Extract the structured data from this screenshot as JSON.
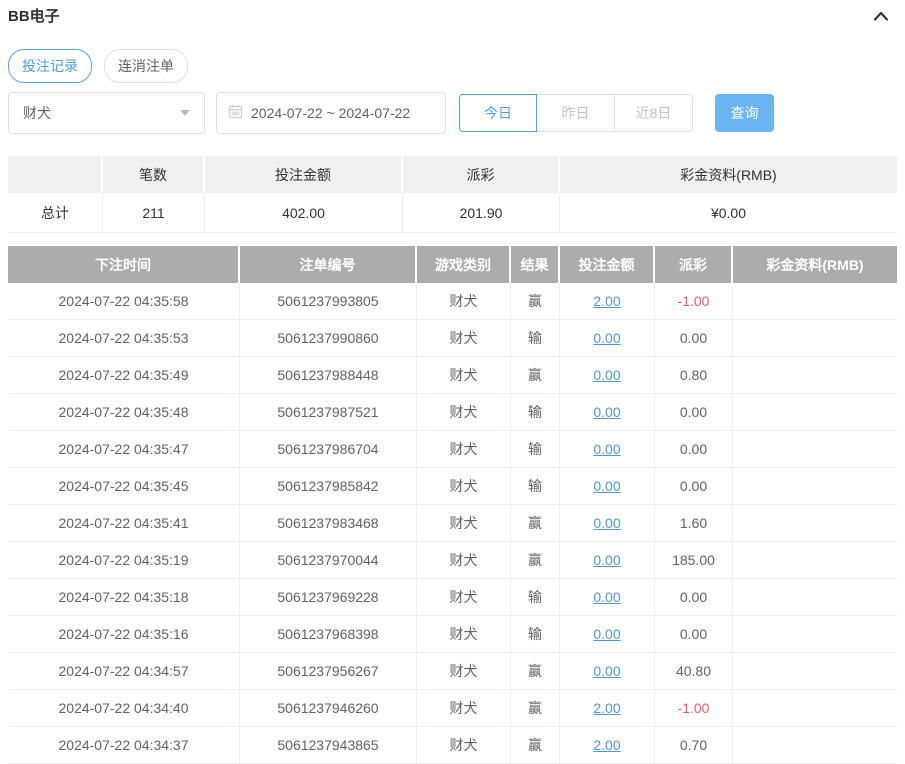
{
  "page": {
    "title": "BB电子"
  },
  "icons": {
    "collapse": "chevron-up-icon",
    "calendar": "calendar-icon",
    "select_caret": "caret-down-icon"
  },
  "colors": {
    "accent_blue": "#4f9fe8",
    "query_button_bg": "#6ab5f1",
    "link_blue": "#4e95dd",
    "negative_red": "#e85c66",
    "records_header_bg": "#acacac",
    "summary_header_bg": "#f0f0f0"
  },
  "tabs": [
    {
      "label": "投注记录",
      "active": true
    },
    {
      "label": "连消注单",
      "active": false
    }
  ],
  "filters": {
    "game_select": {
      "value": "财犬"
    },
    "date_range": {
      "value": "2024-07-22 ~ 2024-07-22"
    },
    "quick_buttons": [
      {
        "label": "今日",
        "active": true
      },
      {
        "label": "昨日",
        "active": false
      },
      {
        "label": "近8日",
        "active": false
      }
    ],
    "query_label": "查询"
  },
  "summary_table": {
    "headers": [
      "",
      "笔数",
      "投注金额",
      "派彩",
      "彩金资料(RMB)"
    ],
    "row": {
      "label": "总计",
      "count": "211",
      "bet_amount": "402.00",
      "payout": "201.90",
      "bonus": "¥0.00"
    }
  },
  "records_table": {
    "headers": [
      "下注时间",
      "注单编号",
      "游戏类别",
      "结果",
      "投注金额",
      "派彩",
      "彩金资料(RMB)"
    ],
    "rows": [
      {
        "time": "2024-07-22 04:35:58",
        "order_no": "5061237993805",
        "game": "财犬",
        "result": "赢",
        "bet_amount": "2.00",
        "payout": "-1.00",
        "bonus": ""
      },
      {
        "time": "2024-07-22 04:35:53",
        "order_no": "5061237990860",
        "game": "财犬",
        "result": "输",
        "bet_amount": "0.00",
        "payout": "0.00",
        "bonus": ""
      },
      {
        "time": "2024-07-22 04:35:49",
        "order_no": "5061237988448",
        "game": "财犬",
        "result": "赢",
        "bet_amount": "0.00",
        "payout": "0.80",
        "bonus": ""
      },
      {
        "time": "2024-07-22 04:35:48",
        "order_no": "5061237987521",
        "game": "财犬",
        "result": "输",
        "bet_amount": "0.00",
        "payout": "0.00",
        "bonus": ""
      },
      {
        "time": "2024-07-22 04:35:47",
        "order_no": "5061237986704",
        "game": "财犬",
        "result": "输",
        "bet_amount": "0.00",
        "payout": "0.00",
        "bonus": ""
      },
      {
        "time": "2024-07-22 04:35:45",
        "order_no": "5061237985842",
        "game": "财犬",
        "result": "输",
        "bet_amount": "0.00",
        "payout": "0.00",
        "bonus": ""
      },
      {
        "time": "2024-07-22 04:35:41",
        "order_no": "5061237983468",
        "game": "财犬",
        "result": "赢",
        "bet_amount": "0.00",
        "payout": "1.60",
        "bonus": ""
      },
      {
        "time": "2024-07-22 04:35:19",
        "order_no": "5061237970044",
        "game": "财犬",
        "result": "赢",
        "bet_amount": "0.00",
        "payout": "185.00",
        "bonus": ""
      },
      {
        "time": "2024-07-22 04:35:18",
        "order_no": "5061237969228",
        "game": "财犬",
        "result": "输",
        "bet_amount": "0.00",
        "payout": "0.00",
        "bonus": ""
      },
      {
        "time": "2024-07-22 04:35:16",
        "order_no": "5061237968398",
        "game": "财犬",
        "result": "输",
        "bet_amount": "0.00",
        "payout": "0.00",
        "bonus": ""
      },
      {
        "time": "2024-07-22 04:34:57",
        "order_no": "5061237956267",
        "game": "财犬",
        "result": "赢",
        "bet_amount": "0.00",
        "payout": "40.80",
        "bonus": ""
      },
      {
        "time": "2024-07-22 04:34:40",
        "order_no": "5061237946260",
        "game": "财犬",
        "result": "赢",
        "bet_amount": "2.00",
        "payout": "-1.00",
        "bonus": ""
      },
      {
        "time": "2024-07-22 04:34:37",
        "order_no": "5061237943865",
        "game": "财犬",
        "result": "赢",
        "bet_amount": "2.00",
        "payout": "0.70",
        "bonus": ""
      }
    ]
  }
}
